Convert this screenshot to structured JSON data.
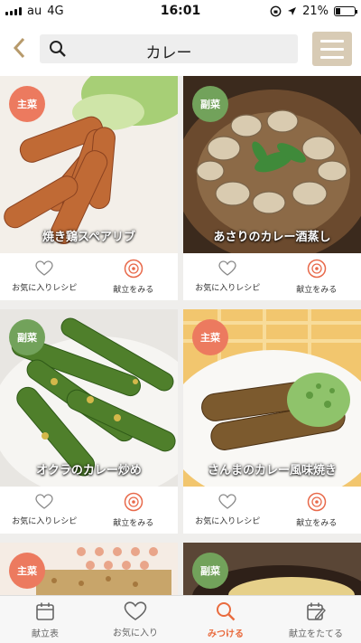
{
  "status_bar": {
    "carrier": "au",
    "network": "4G",
    "time": "16:01",
    "battery": "21%"
  },
  "search": {
    "query": "カレー"
  },
  "cards": [
    {
      "badge": "主菜",
      "title": "焼き鶏スペアリブ",
      "favorite_label": "お気に入りレシピ",
      "menu_label": "献立をみる"
    },
    {
      "badge": "副菜",
      "title": "あさりのカレー酒蒸し",
      "favorite_label": "お気に入りレシピ",
      "menu_label": "献立をみる"
    },
    {
      "badge": "副菜",
      "title": "オクラのカレー炒め",
      "favorite_label": "お気に入りレシピ",
      "menu_label": "献立をみる"
    },
    {
      "badge": "主菜",
      "title": "さんまのカレー風味焼き",
      "favorite_label": "お気に入りレシピ",
      "menu_label": "献立をみる"
    },
    {
      "badge": "主菜"
    },
    {
      "badge": "副菜"
    }
  ],
  "tabbar": {
    "items": [
      {
        "label": "献立表",
        "icon": "calendar-icon"
      },
      {
        "label": "お気に入り",
        "icon": "heart-icon"
      },
      {
        "label": "みつける",
        "icon": "search-icon"
      },
      {
        "label": "献立をたてる",
        "icon": "edit-calendar-icon"
      }
    ],
    "active_color": "#e96b3e"
  },
  "colors": {
    "main_badge": "#ec7a5f",
    "side_badge": "#72a25b",
    "menu_button": "#d8cbb5"
  }
}
